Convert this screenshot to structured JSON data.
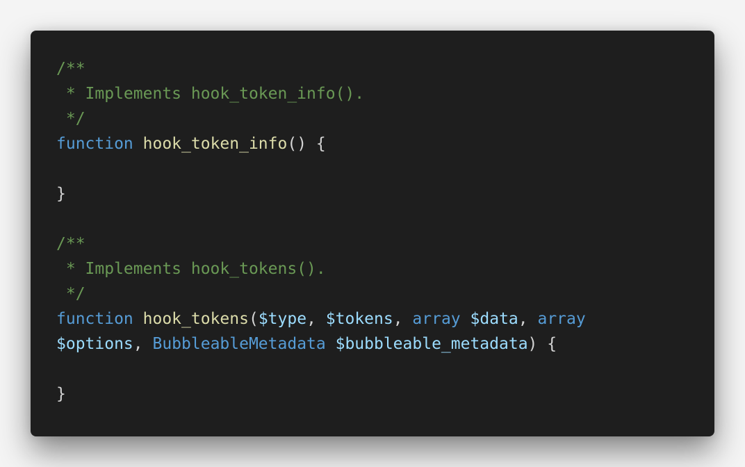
{
  "lines": [
    [
      {
        "t": "/**",
        "c": "comment"
      }
    ],
    [
      {
        "t": " * Implements hook_token_info().",
        "c": "comment"
      }
    ],
    [
      {
        "t": " */",
        "c": "comment"
      }
    ],
    [
      {
        "t": "function",
        "c": "keyword"
      },
      {
        "t": " ",
        "c": "punct"
      },
      {
        "t": "hook_token_info",
        "c": "fn"
      },
      {
        "t": "() {",
        "c": "punct"
      }
    ],
    [],
    [
      {
        "t": "}",
        "c": "punct"
      }
    ],
    [],
    [
      {
        "t": "/**",
        "c": "comment"
      }
    ],
    [
      {
        "t": " * Implements hook_tokens().",
        "c": "comment"
      }
    ],
    [
      {
        "t": " */",
        "c": "comment"
      }
    ],
    [
      {
        "t": "function",
        "c": "keyword"
      },
      {
        "t": " ",
        "c": "punct"
      },
      {
        "t": "hook_tokens",
        "c": "fn"
      },
      {
        "t": "(",
        "c": "punct"
      },
      {
        "t": "$type",
        "c": "var"
      },
      {
        "t": ", ",
        "c": "punct"
      },
      {
        "t": "$tokens",
        "c": "var"
      },
      {
        "t": ", ",
        "c": "punct"
      },
      {
        "t": "array",
        "c": "type"
      },
      {
        "t": " ",
        "c": "punct"
      },
      {
        "t": "$data",
        "c": "var"
      },
      {
        "t": ", ",
        "c": "punct"
      },
      {
        "t": "array",
        "c": "type"
      }
    ],
    [
      {
        "t": "$options",
        "c": "var"
      },
      {
        "t": ", ",
        "c": "punct"
      },
      {
        "t": "BubbleableMetadata",
        "c": "type"
      },
      {
        "t": " ",
        "c": "punct"
      },
      {
        "t": "$bubbleable_metadata",
        "c": "var"
      },
      {
        "t": ") {",
        "c": "punct"
      }
    ],
    [],
    [
      {
        "t": "}",
        "c": "punct"
      }
    ]
  ]
}
